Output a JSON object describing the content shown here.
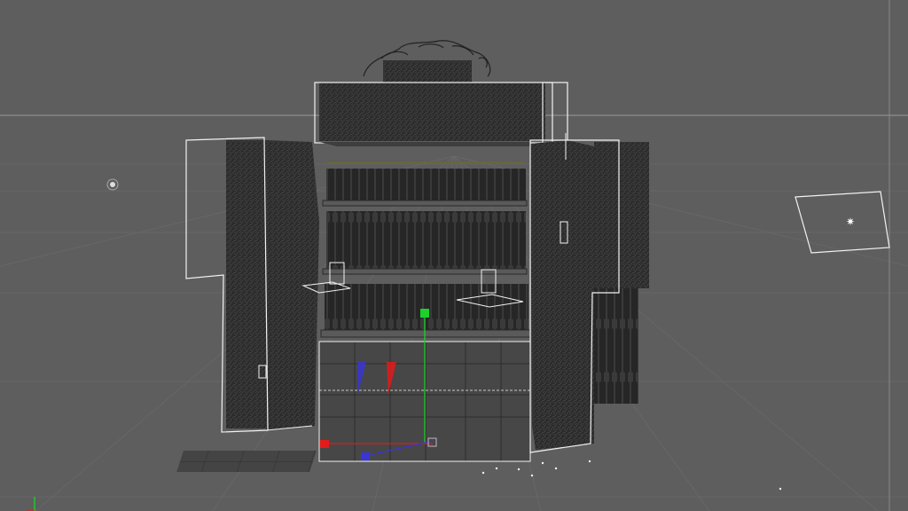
{
  "app": {
    "view_type": "3D viewport (wireframe + shaded)",
    "colors": {
      "background": "#5e5e5e",
      "grid_line": "#6a6a6a",
      "horizon_line": "#9a9a9a",
      "wire": "#f2f2f2",
      "mesh_dark": "#2b2b2b",
      "mesh_mid": "#3a3a3a",
      "gizmo_x": "#e31b1b",
      "gizmo_y": "#1bd12b",
      "gizmo_z": "#3a35d6"
    }
  },
  "scene": {
    "objects": [
      {
        "name": "display-stand",
        "icon": "box-mesh-icon"
      },
      {
        "name": "left-door-panel",
        "icon": "plane-icon"
      },
      {
        "name": "right-door-panel",
        "icon": "plane-icon"
      },
      {
        "name": "top-header-sign",
        "icon": "plane-icon"
      },
      {
        "name": "bottle-shelves",
        "icon": "cylinder-array-icon"
      },
      {
        "name": "area-light",
        "icon": "light-icon"
      },
      {
        "name": "point-light",
        "icon": "light-icon"
      }
    ],
    "transform_gizmo": {
      "axes": [
        "X",
        "Y",
        "Z"
      ],
      "selected_axis": "none"
    }
  }
}
